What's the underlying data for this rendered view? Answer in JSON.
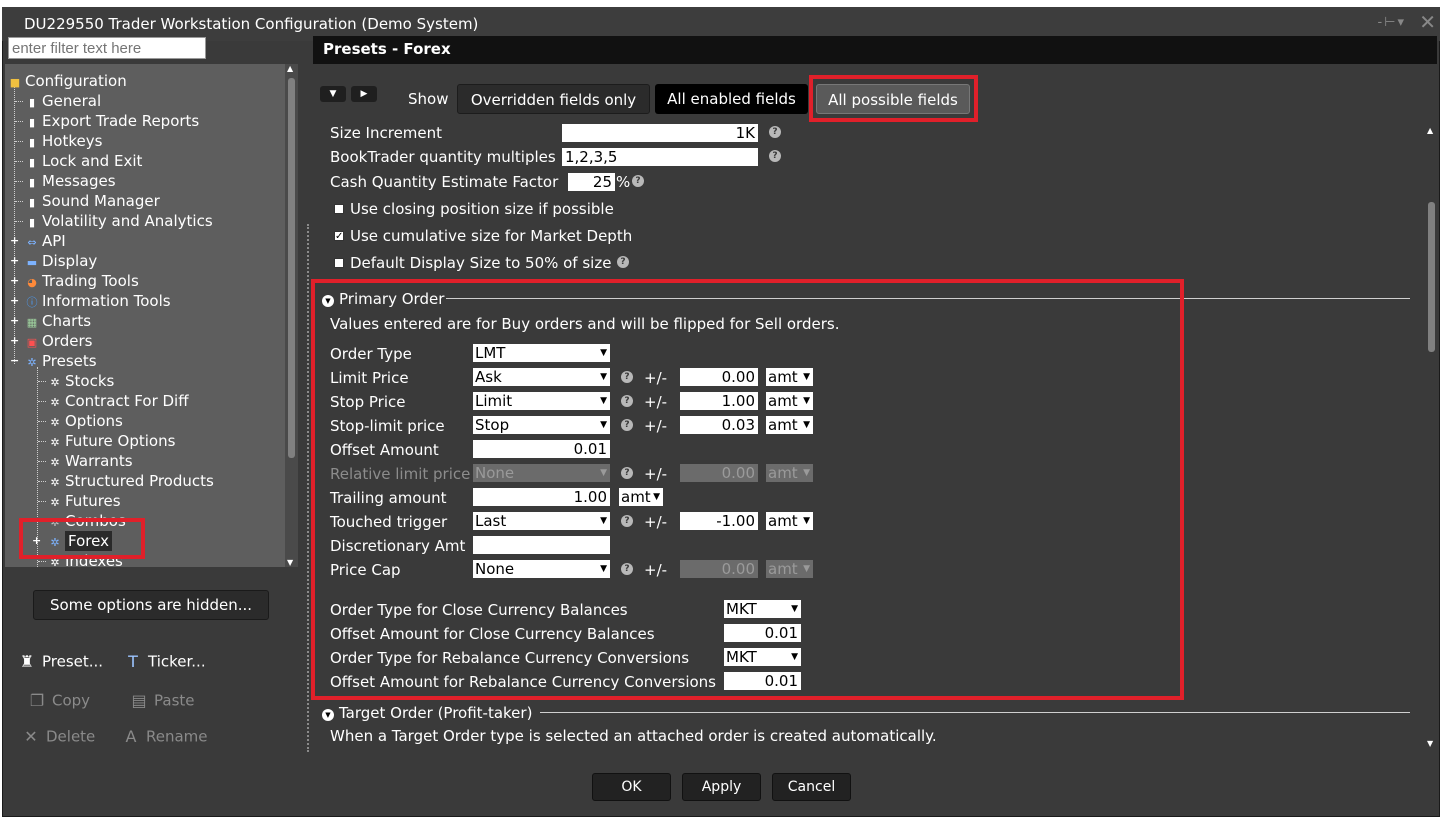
{
  "window": {
    "title": "DU229550 Trader Workstation Configuration (Demo System)"
  },
  "filter": {
    "placeholder": "enter filter text here"
  },
  "tree": {
    "root": "Configuration",
    "items": [
      "General",
      "Export Trade Reports",
      "Hotkeys",
      "Lock and Exit",
      "Messages",
      "Sound Manager",
      "Volatility and Analytics"
    ],
    "groups": [
      "API",
      "Display",
      "Trading Tools",
      "Information Tools",
      "Charts",
      "Orders",
      "Presets"
    ],
    "presets": [
      "Stocks",
      "Contract For Diff",
      "Options",
      "Future Options",
      "Warrants",
      "Structured Products",
      "Futures",
      "Combos",
      "Forex",
      "Indexes"
    ],
    "selected": "Forex"
  },
  "left_buttons": {
    "hidden_options": "Some options are hidden...",
    "preset": "Preset...",
    "ticker": "Ticker...",
    "copy": "Copy",
    "paste": "Paste",
    "delete": "Delete",
    "rename": "Rename"
  },
  "panel": {
    "title": "Presets - Forex",
    "show_label": "Show",
    "toggles": {
      "overridden": "Overridden fields only",
      "enabled": "All enabled fields",
      "possible": "All possible fields"
    }
  },
  "general": {
    "size_increment": {
      "label": "Size Increment",
      "value": "1K"
    },
    "booktrader_multiples": {
      "label": "BookTrader quantity multiples",
      "value": "1,2,3,5"
    },
    "cash_qty_factor": {
      "label": "Cash Quantity Estimate Factor",
      "value": "25",
      "unit": "%"
    },
    "checkboxes": [
      {
        "label": "Use closing position size if possible",
        "checked": false
      },
      {
        "label": "Use cumulative size for Market Depth",
        "checked": true
      },
      {
        "label": "Default Display Size to 50% of size",
        "checked": false
      }
    ]
  },
  "primary_order": {
    "title": "Primary Order",
    "note": "Values entered are for Buy orders and will be flipped for Sell orders.",
    "plusminus": "+/-",
    "rows": {
      "order_type": {
        "label": "Order Type",
        "value": "LMT"
      },
      "limit_price": {
        "label": "Limit Price",
        "value": "Ask",
        "offset": "0.00",
        "unit": "amt"
      },
      "stop_price": {
        "label": "Stop Price",
        "value": "Limit",
        "offset": "1.00",
        "unit": "amt"
      },
      "stop_limit_price": {
        "label": "Stop-limit price",
        "value": "Stop",
        "offset": "0.03",
        "unit": "amt"
      },
      "offset_amount": {
        "label": "Offset Amount",
        "value": "0.01"
      },
      "relative_limit": {
        "label": "Relative limit price",
        "value": "None",
        "offset": "0.00",
        "unit": "amt"
      },
      "trailing_amount": {
        "label": "Trailing amount",
        "value": "1.00",
        "unit": "amt"
      },
      "touched_trigger": {
        "label": "Touched trigger",
        "value": "Last",
        "offset": "-1.00",
        "unit": "amt"
      },
      "discretionary": {
        "label": "Discretionary Amt",
        "value": ""
      },
      "price_cap": {
        "label": "Price Cap",
        "value": "None",
        "offset": "0.00",
        "unit": "amt"
      }
    },
    "currency": {
      "close_type": {
        "label": "Order Type for Close Currency Balances",
        "value": "MKT"
      },
      "close_offset": {
        "label": "Offset Amount for Close Currency Balances",
        "value": "0.01"
      },
      "rebalance_type": {
        "label": "Order Type for Rebalance Currency Conversions",
        "value": "MKT"
      },
      "rebalance_offset": {
        "label": "Offset Amount for Rebalance Currency Conversions",
        "value": "0.01"
      }
    }
  },
  "target_order": {
    "title": "Target Order (Profit-taker)",
    "note": "When a Target Order type is selected an attached order is created automatically."
  },
  "dialog": {
    "ok": "OK",
    "apply": "Apply",
    "cancel": "Cancel"
  },
  "colors": {
    "highlight": "#e0202a",
    "background": "#3a3a3a",
    "header": "#111111"
  }
}
